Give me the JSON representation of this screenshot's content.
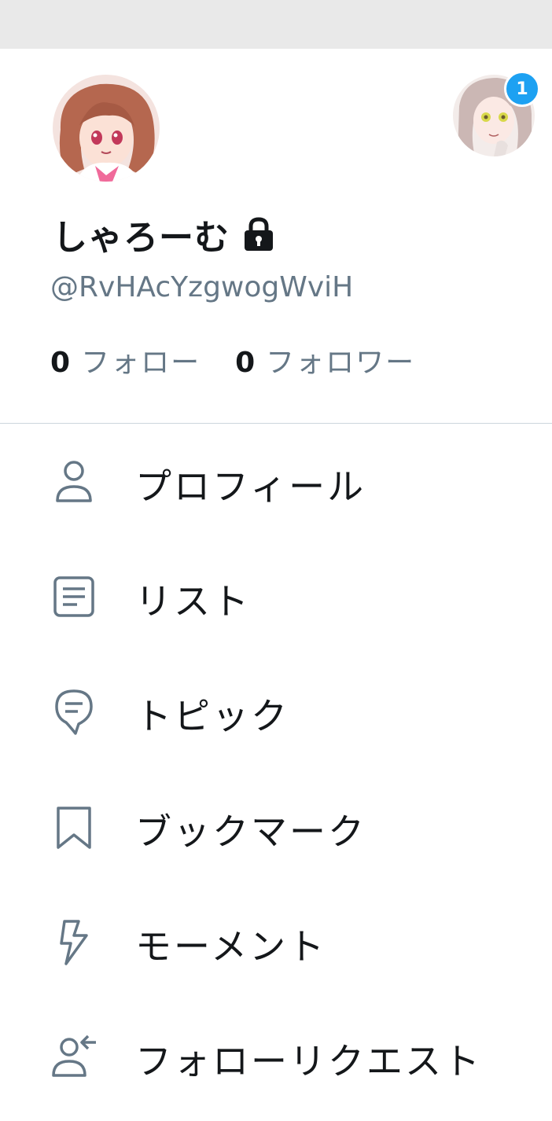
{
  "profile": {
    "display_name": "しゃろーむ",
    "handle": "@RvHAcYzgwogWviH",
    "following_count": "0",
    "following_label": "フォロー",
    "followers_count": "0",
    "followers_label": "フォロワー",
    "avatar_icon": "anime-girl-avatar",
    "lock_icon": "lock-icon"
  },
  "account_switcher": {
    "badge_count": "1",
    "badge_color": "#1da1f2"
  },
  "menu": [
    {
      "label": "プロフィール",
      "icon": "person-icon"
    },
    {
      "label": "リスト",
      "icon": "list-icon"
    },
    {
      "label": "トピック",
      "icon": "topic-bubble-icon"
    },
    {
      "label": "ブックマーク",
      "icon": "bookmark-icon"
    },
    {
      "label": "モーメント",
      "icon": "lightning-icon"
    },
    {
      "label": "フォローリクエスト",
      "icon": "follow-request-icon"
    }
  ],
  "colors": {
    "text_primary": "#14171a",
    "text_secondary": "#657786",
    "icon": "#657786",
    "divider": "#ccd6dd",
    "accent": "#1da1f2"
  }
}
